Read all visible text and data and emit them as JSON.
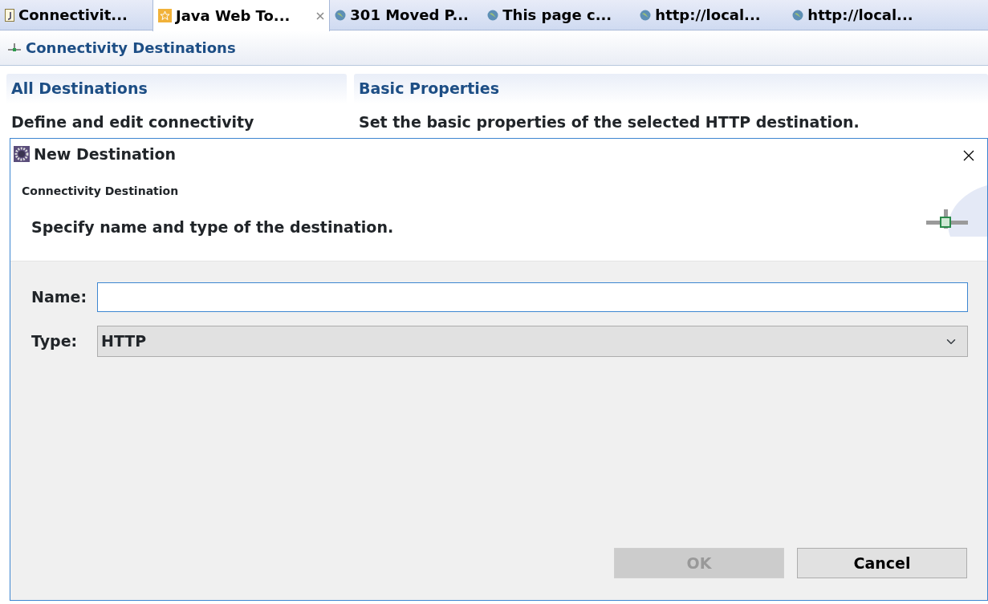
{
  "editor_tabs": [
    {
      "label": "Connectivit...",
      "kind": "file",
      "selected": false
    },
    {
      "label": "Java Web To...",
      "kind": "tool",
      "selected": true
    },
    {
      "label": "301 Moved P...",
      "kind": "web",
      "selected": false
    },
    {
      "label": "This page c...",
      "kind": "web",
      "selected": false
    },
    {
      "label": "http://local...",
      "kind": "web",
      "selected": false
    },
    {
      "label": "http://local...",
      "kind": "web",
      "selected": false
    }
  ],
  "editor": {
    "title": "Connectivity Destinations",
    "sections": [
      {
        "title": "All Destinations",
        "description": "Define and edit connectivity"
      },
      {
        "title": "Basic Properties",
        "description": "Set the basic properties of the selected HTTP destination."
      }
    ]
  },
  "dialog": {
    "title": "New Destination",
    "page_title": "Connectivity Destination",
    "message": "Specify name and type of the destination.",
    "fields": [
      {
        "label": "Name:",
        "kind": "text"
      },
      {
        "label": "Type:",
        "kind": "select",
        "value": "HTTP"
      }
    ],
    "buttons": [
      {
        "label": "OK",
        "disabled": true
      },
      {
        "label": "Cancel",
        "disabled": false
      }
    ]
  }
}
